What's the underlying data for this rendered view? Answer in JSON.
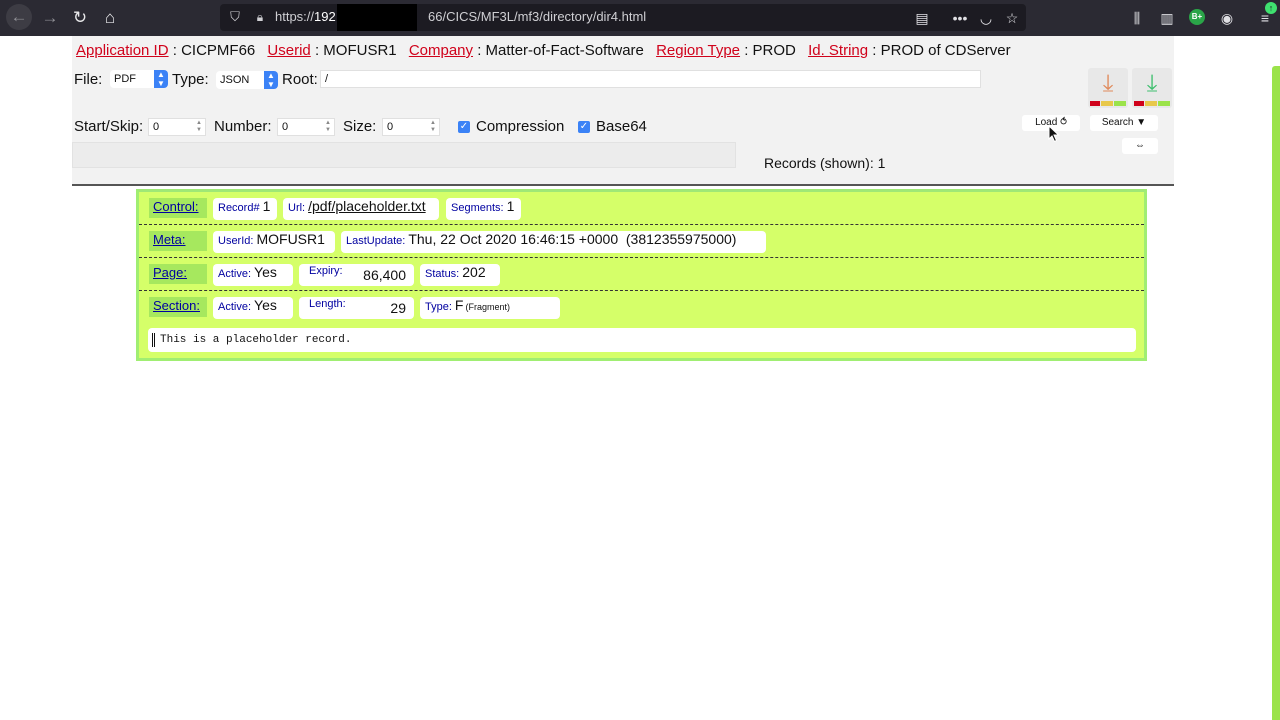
{
  "browser": {
    "url_prefix": "https://",
    "url_host": "192",
    "url_rest": "66/CICS/MF3L/mf3/directory/dir4.html",
    "ext_badge": "B+"
  },
  "info": {
    "app_id_label": "Application ID",
    "app_id_value": ": CICPMF66",
    "userid_label": "Userid",
    "userid_value": ": MOFUSR1",
    "company_label": "Company",
    "company_value": ": Matter-of-Fact-Software",
    "region_label": "Region Type",
    "region_value": ": PROD",
    "idstring_label": "Id. String",
    "idstring_value": ": PROD of CDServer"
  },
  "form": {
    "file_label": "File:",
    "file_value": "PDF",
    "type_label": "Type:",
    "type_value": "JSON",
    "root_label": "Root:",
    "root_value": "/",
    "start_label": "Start/Skip:",
    "start_value": "0",
    "number_label": "Number:",
    "number_value": "0",
    "size_label": "Size:",
    "size_value": "0",
    "compression_label": "Compression",
    "base64_label": "Base64",
    "load_label": "Load ⥀",
    "search_label": "Search ▼",
    "toggle_label": "⇔"
  },
  "records_shown": "Records (shown): 1",
  "record": {
    "control_tag": "Control:",
    "record_key": "Record#",
    "record_val": "1",
    "url_key": "Url:",
    "url_val": "/pdf/placeholder.txt",
    "segments_key": "Segments:",
    "segments_val": "1",
    "meta_tag": "Meta:",
    "meta_userid_key": "UserId:",
    "meta_userid_val": "MOFUSR1",
    "lastupdate_key": "LastUpdate:",
    "lastupdate_val": "Thu, 22 Oct 2020 16:46:15 +0000  (3812355975000)",
    "page_tag": "Page:",
    "page_active_key": "Active:",
    "page_active_val": "Yes",
    "expiry_key": "Expiry:",
    "expiry_val": "86,400",
    "status_key": "Status:",
    "status_val": "202",
    "section_tag": "Section:",
    "section_active_key": "Active:",
    "section_active_val": "Yes",
    "length_key": "Length:",
    "length_val": "29",
    "type_key": "Type:",
    "type_val": "F",
    "type_note": "(Fragment)",
    "content": "This is a placeholder record."
  },
  "colors": {
    "label_red": "#d0021b",
    "card_green": "#d5ff69",
    "key_blue": "#0000a0"
  }
}
